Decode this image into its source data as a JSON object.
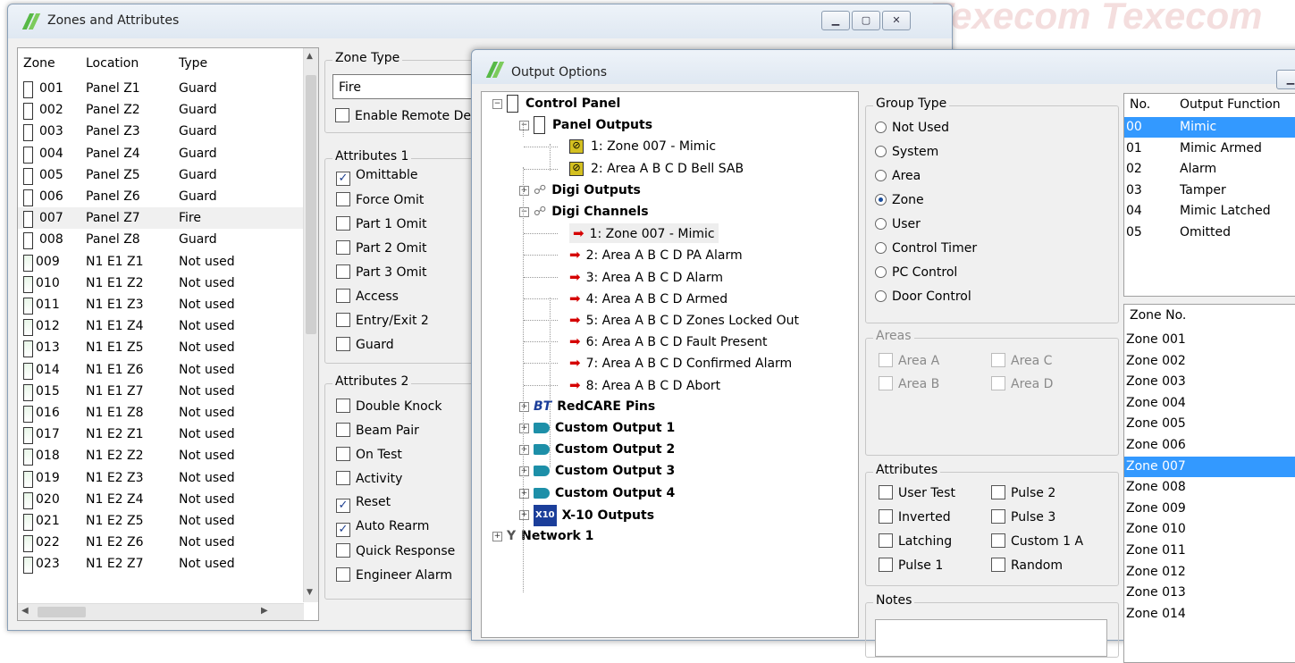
{
  "watermark": [
    "Texecom",
    "Texecom",
    "Texecom"
  ],
  "zones_window": {
    "title": "Zones and Attributes",
    "controls": [
      "minimize",
      "maximize",
      "close"
    ],
    "columns": [
      "Zone",
      "Location",
      "Type"
    ],
    "rows": [
      {
        "zone": "001",
        "location": "Panel Z1",
        "type": "Guard"
      },
      {
        "zone": "002",
        "location": "Panel Z2",
        "type": "Guard"
      },
      {
        "zone": "003",
        "location": "Panel Z3",
        "type": "Guard"
      },
      {
        "zone": "004",
        "location": "Panel Z4",
        "type": "Guard"
      },
      {
        "zone": "005",
        "location": "Panel Z5",
        "type": "Guard"
      },
      {
        "zone": "006",
        "location": "Panel Z6",
        "type": "Guard"
      },
      {
        "zone": "007",
        "location": "Panel Z7",
        "type": "Fire"
      },
      {
        "zone": "008",
        "location": "Panel Z8",
        "type": "Guard"
      },
      {
        "zone": "009",
        "location": "N1 E1 Z1",
        "type": "Not used"
      },
      {
        "zone": "010",
        "location": "N1 E1 Z2",
        "type": "Not used"
      },
      {
        "zone": "011",
        "location": "N1 E1 Z3",
        "type": "Not used"
      },
      {
        "zone": "012",
        "location": "N1 E1 Z4",
        "type": "Not used"
      },
      {
        "zone": "013",
        "location": "N1 E1 Z5",
        "type": "Not used"
      },
      {
        "zone": "014",
        "location": "N1 E1 Z6",
        "type": "Not used"
      },
      {
        "zone": "015",
        "location": "N1 E1 Z7",
        "type": "Not used"
      },
      {
        "zone": "016",
        "location": "N1 E1 Z8",
        "type": "Not used"
      },
      {
        "zone": "017",
        "location": "N1 E2 Z1",
        "type": "Not used"
      },
      {
        "zone": "018",
        "location": "N1 E2 Z2",
        "type": "Not used"
      },
      {
        "zone": "019",
        "location": "N1 E2 Z3",
        "type": "Not used"
      },
      {
        "zone": "020",
        "location": "N1 E2 Z4",
        "type": "Not used"
      },
      {
        "zone": "021",
        "location": "N1 E2 Z5",
        "type": "Not used"
      },
      {
        "zone": "022",
        "location": "N1 E2 Z6",
        "type": "Not used"
      },
      {
        "zone": "023",
        "location": "N1 E2 Z7",
        "type": "Not used"
      }
    ],
    "selected_row": "007",
    "zone_type_label": "Zone Type",
    "zone_type_value": "Fire",
    "enable_remote_label": "Enable Remote De",
    "attributes1_label": "Attributes 1",
    "attributes1": [
      {
        "label": "Omittable",
        "checked": true
      },
      {
        "label": "Force Omit",
        "checked": false
      },
      {
        "label": "Part 1 Omit",
        "checked": false
      },
      {
        "label": "Part 2 Omit",
        "checked": false
      },
      {
        "label": "Part 3 Omit",
        "checked": false
      },
      {
        "label": "Access",
        "checked": false
      },
      {
        "label": "Entry/Exit 2",
        "checked": false
      },
      {
        "label": "Guard",
        "checked": false
      }
    ],
    "attributes2_label": "Attributes 2",
    "attributes2": [
      {
        "label": "Double Knock",
        "checked": false
      },
      {
        "label": "Beam Pair",
        "checked": false
      },
      {
        "label": "On Test",
        "checked": false
      },
      {
        "label": "Activity",
        "checked": false
      },
      {
        "label": "Reset",
        "checked": true
      },
      {
        "label": "Auto Rearm",
        "checked": true
      },
      {
        "label": "Quick Response",
        "checked": false
      },
      {
        "label": "Engineer Alarm",
        "checked": false
      }
    ]
  },
  "output_window": {
    "title": "Output Options",
    "tree": [
      {
        "label": "Control Panel",
        "bold": true,
        "level": 0,
        "expander": "−",
        "icon": "panel-icon"
      },
      {
        "label": "Panel Outputs",
        "bold": true,
        "level": 1,
        "expander": "−",
        "icon": "panel-icon"
      },
      {
        "label": "1: Zone 007 - Mimic",
        "bold": false,
        "level": 2,
        "icon": "output-icon"
      },
      {
        "label": "2: Area A B C D Bell SAB",
        "bold": false,
        "level": 2,
        "icon": "output-icon"
      },
      {
        "label": "Digi Outputs",
        "bold": true,
        "level": 1,
        "expander": "+",
        "icon": "digi-icon"
      },
      {
        "label": "Digi Channels",
        "bold": true,
        "level": 1,
        "expander": "−",
        "icon": "digi-icon"
      },
      {
        "label": "1: Zone 007 - Mimic",
        "bold": false,
        "level": 2,
        "icon": "arrow-icon",
        "selected": true
      },
      {
        "label": "2: Area A B C D PA Alarm",
        "bold": false,
        "level": 2,
        "icon": "arrow-icon"
      },
      {
        "label": "3: Area A B C D Alarm",
        "bold": false,
        "level": 2,
        "icon": "arrow-icon"
      },
      {
        "label": "4: Area A B C D Armed",
        "bold": false,
        "level": 2,
        "icon": "arrow-icon"
      },
      {
        "label": "5: Area A B C D Zones Locked Out",
        "bold": false,
        "level": 2,
        "icon": "arrow-icon"
      },
      {
        "label": "6: Area A B C D Fault Present",
        "bold": false,
        "level": 2,
        "icon": "arrow-icon"
      },
      {
        "label": "7: Area A B C D Confirmed Alarm",
        "bold": false,
        "level": 2,
        "icon": "arrow-icon"
      },
      {
        "label": "8: Area A B C D Abort",
        "bold": false,
        "level": 2,
        "icon": "arrow-icon"
      },
      {
        "label": "RedCARE Pins",
        "bold": true,
        "level": 1,
        "expander": "+",
        "icon": "bt-icon"
      },
      {
        "label": "Custom Output 1",
        "bold": true,
        "level": 1,
        "expander": "+",
        "icon": "custom-output-icon"
      },
      {
        "label": "Custom Output 2",
        "bold": true,
        "level": 1,
        "expander": "+",
        "icon": "custom-output-icon"
      },
      {
        "label": "Custom Output 3",
        "bold": true,
        "level": 1,
        "expander": "+",
        "icon": "custom-output-icon"
      },
      {
        "label": "Custom Output 4",
        "bold": true,
        "level": 1,
        "expander": "+",
        "icon": "custom-output-icon"
      },
      {
        "label": "X-10 Outputs",
        "bold": true,
        "level": 1,
        "expander": "+",
        "icon": "x10-icon"
      },
      {
        "label": "Network 1",
        "bold": true,
        "level": 0,
        "expander": "+",
        "icon": "network-icon"
      }
    ],
    "bt_icon_text": "BT",
    "x10_icon_text": "X10",
    "group_type_label": "Group Type",
    "group_types": [
      {
        "label": "Not Used",
        "selected": false
      },
      {
        "label": "System",
        "selected": false
      },
      {
        "label": "Area",
        "selected": false
      },
      {
        "label": "Zone",
        "selected": true
      },
      {
        "label": "User",
        "selected": false
      },
      {
        "label": "Control Timer",
        "selected": false
      },
      {
        "label": "PC Control",
        "selected": false
      },
      {
        "label": "Door Control",
        "selected": false
      }
    ],
    "areas_label": "Areas",
    "areas": [
      "Area A",
      "Area C",
      "Area B",
      "Area D"
    ],
    "attributes_label": "Attributes",
    "attributes": [
      {
        "label": "User Test",
        "checked": false
      },
      {
        "label": "Pulse 2",
        "checked": false
      },
      {
        "label": "Inverted",
        "checked": false
      },
      {
        "label": "Pulse 3",
        "checked": false
      },
      {
        "label": "Latching",
        "checked": false
      },
      {
        "label": "Custom 1 A",
        "checked": false
      },
      {
        "label": "Pulse 1",
        "checked": false
      },
      {
        "label": "Random",
        "checked": false
      }
    ],
    "notes_label": "Notes",
    "function_columns": [
      "No.",
      "Output Function"
    ],
    "functions": [
      {
        "no": "00",
        "name": "Mimic",
        "selected": true
      },
      {
        "no": "01",
        "name": "Mimic Armed",
        "selected": false
      },
      {
        "no": "02",
        "name": "Alarm",
        "selected": false
      },
      {
        "no": "03",
        "name": "Tamper",
        "selected": false
      },
      {
        "no": "04",
        "name": "Mimic Latched",
        "selected": false
      },
      {
        "no": "05",
        "name": "Omitted",
        "selected": false
      }
    ],
    "zone_no_label": "Zone No.",
    "zones": [
      "Zone 001",
      "Zone 002",
      "Zone 003",
      "Zone 004",
      "Zone 005",
      "Zone 006",
      "Zone 007",
      "Zone 008",
      "Zone 009",
      "Zone 010",
      "Zone 011",
      "Zone 012",
      "Zone 013",
      "Zone 014"
    ],
    "selected_zone": "Zone 007"
  },
  "colors": {
    "selection": "#3399ff",
    "arrow": "#d50000",
    "logo": "#57b947"
  }
}
